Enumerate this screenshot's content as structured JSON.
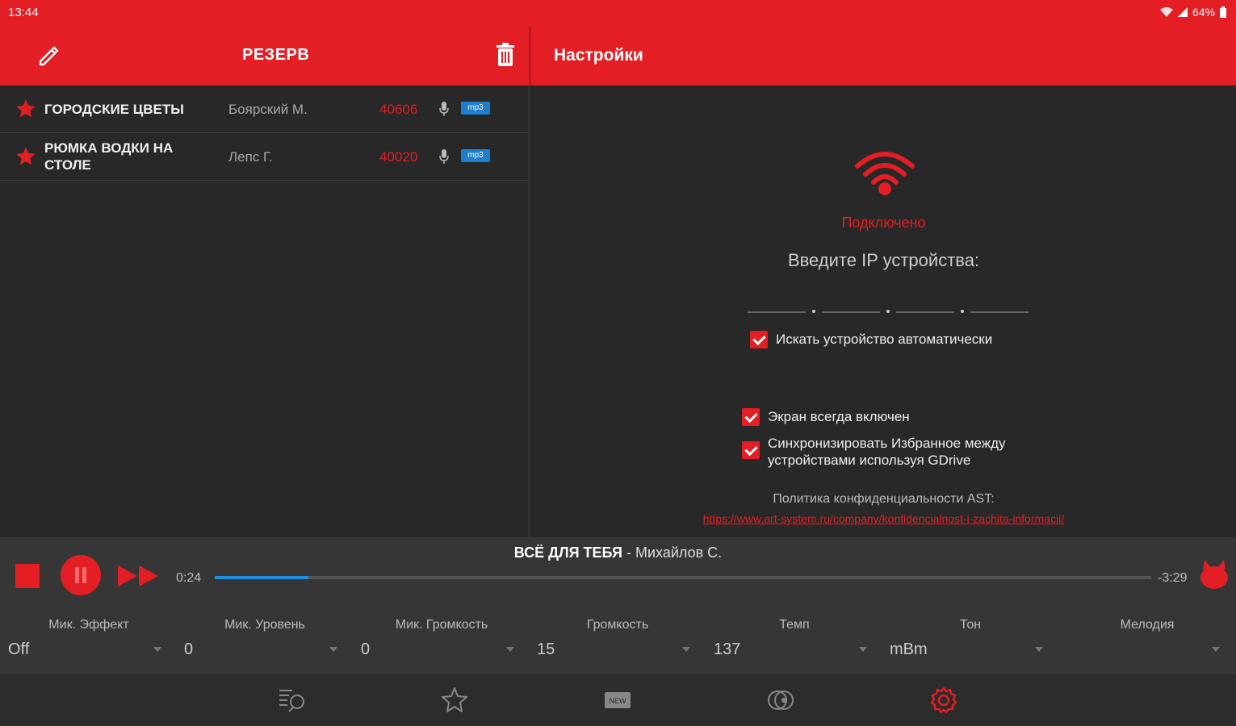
{
  "status_bar": {
    "time": "13:44",
    "battery": "64%"
  },
  "header": {
    "list_title": "РЕЗЕРВ",
    "settings_title": "Настройки"
  },
  "songs": [
    {
      "title": "ГОРОДСКИЕ ЦВЕТЫ",
      "artist": "Боярский М.",
      "number": "40606",
      "format": "mp3"
    },
    {
      "title": "РЮМКА ВОДКИ НА СТОЛЕ",
      "artist": "Лепс Г.",
      "number": "40020",
      "format": "mp3"
    }
  ],
  "settings": {
    "connection_status": "Подключено",
    "ip_prompt": "Введите IP устройства:",
    "auto_search_label": "Искать устройство автоматически",
    "auto_search_checked": true,
    "screen_on_label": "Экран всегда включен",
    "screen_on_checked": true,
    "sync_label": "Синхронизировать Избранное между устройствами используя GDrive",
    "sync_checked": true,
    "policy_label": "Политика конфиденциальности AST:",
    "policy_link": "https://www.art-system.ru/company/konfidencialnost-i-zachita-informacii/"
  },
  "player": {
    "song_title": "ВСЁ ДЛЯ ТЕБЯ",
    "song_artist": "Михайлов С.",
    "separator": " - ",
    "elapsed": "0:24",
    "remaining": "-3:29",
    "progress_fraction": 0.1
  },
  "controls": [
    {
      "label": "Мик. Эффект",
      "value": "Off"
    },
    {
      "label": "Мик. Уровень",
      "value": "0"
    },
    {
      "label": "Мик. Громкость",
      "value": "0"
    },
    {
      "label": "Громкость",
      "value": "15"
    },
    {
      "label": "Темп",
      "value": "137"
    },
    {
      "label": "Тон",
      "value": "mBm"
    },
    {
      "label": "Мелодия",
      "value": ""
    }
  ],
  "colors": {
    "accent": "#e31e24",
    "background": "#282828",
    "player_bg": "#363636",
    "progress": "#1e90e0"
  },
  "bottom_nav": [
    {
      "name": "playlist-icon",
      "active": false
    },
    {
      "name": "star-icon",
      "active": false
    },
    {
      "name": "new-icon",
      "active": false
    },
    {
      "name": "discs-icon",
      "active": false
    },
    {
      "name": "settings-gear-icon",
      "active": true
    }
  ]
}
